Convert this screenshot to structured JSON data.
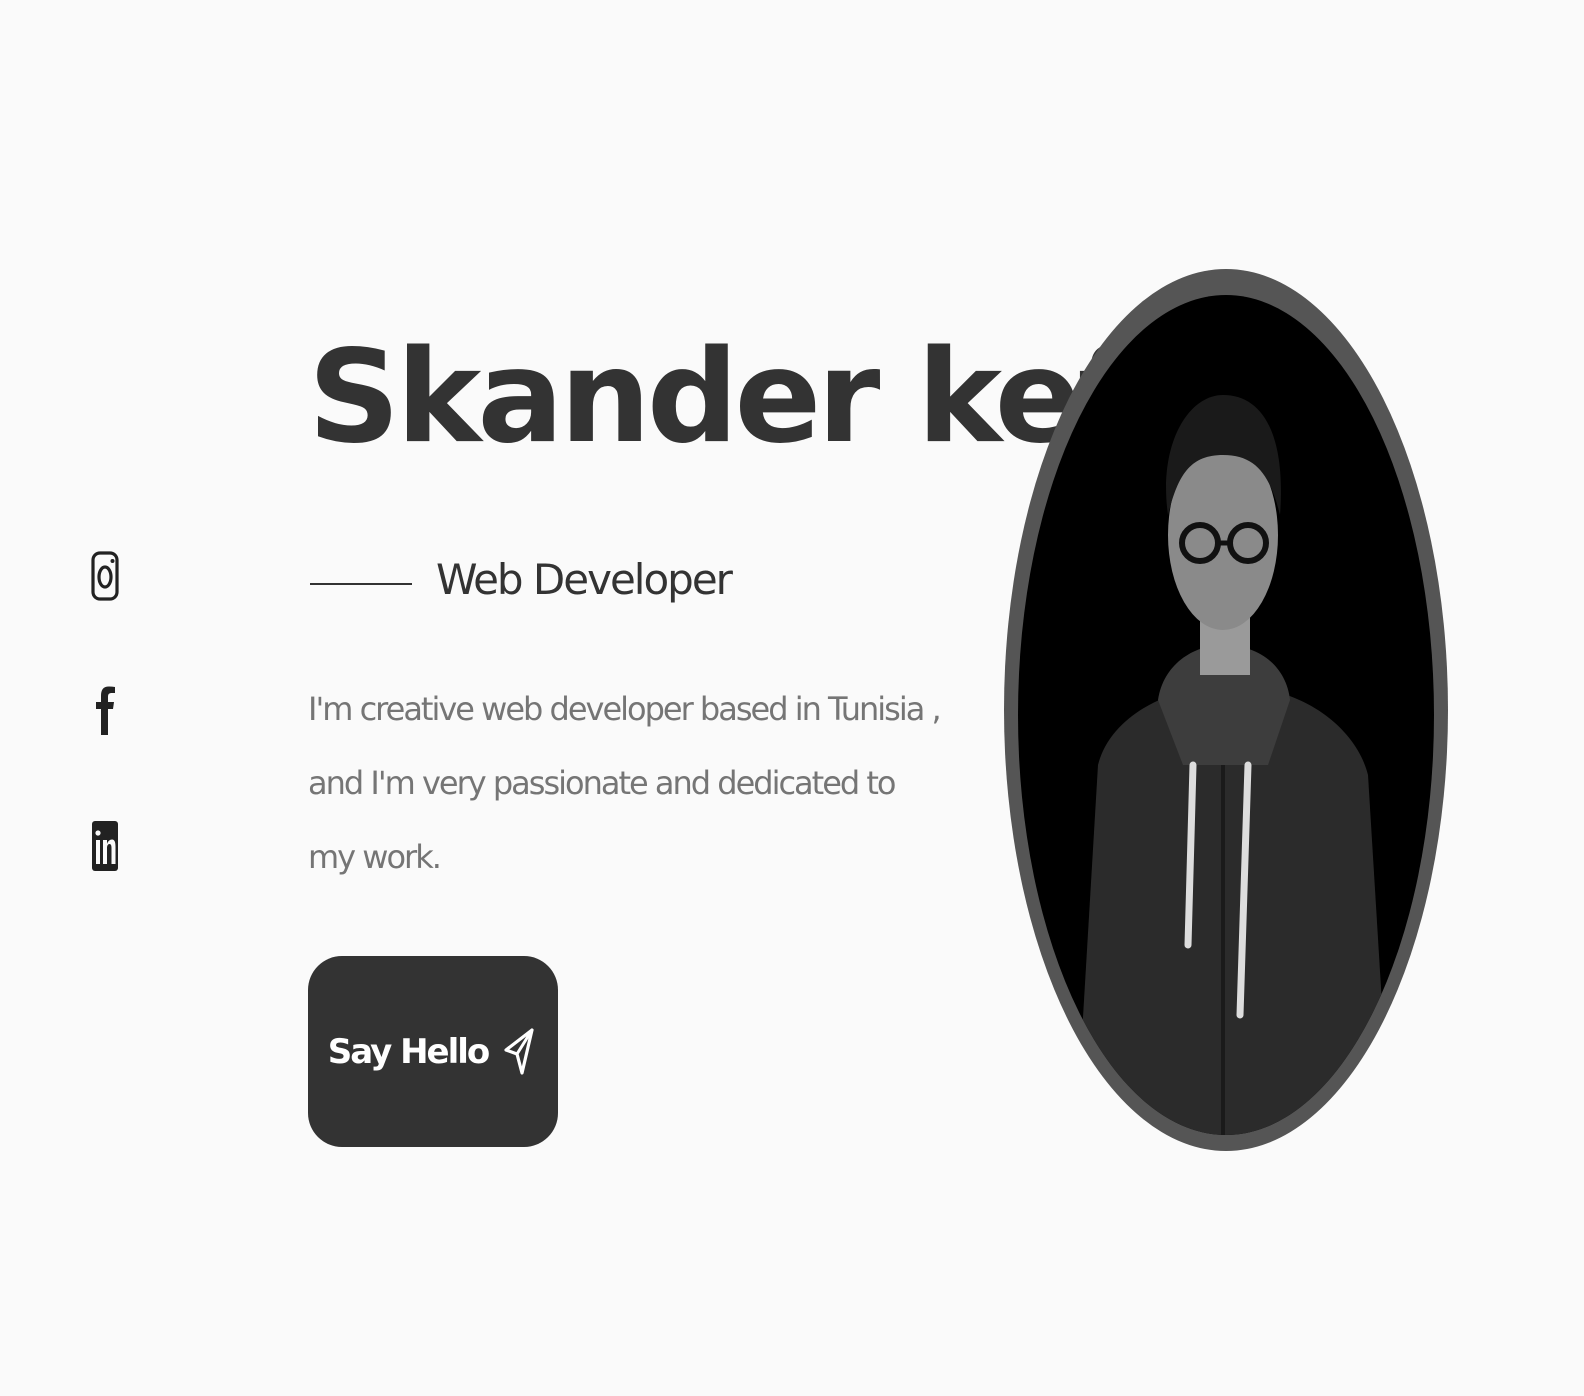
{
  "hero": {
    "name": "Skander kefi",
    "wave_icon": "waving-hand-emoji",
    "subtitle": "Web Developer",
    "description": "I'm creative web developer based in Tunisia , and I'm very passionate and dedicated to my work.",
    "cta_label": "Say Hello",
    "cta_icon": "send-icon"
  },
  "social": {
    "items": [
      {
        "icon": "instagram-icon"
      },
      {
        "icon": "facebook-icon"
      },
      {
        "icon": "linkedin-icon"
      }
    ]
  },
  "portrait": {
    "icon": "profile-photo"
  },
  "colors": {
    "background": "#fafafa",
    "primary_text": "#333333",
    "muted_text": "#757575",
    "button_bg": "#333333",
    "button_text": "#ffffff",
    "photo_ring": "#555555"
  }
}
